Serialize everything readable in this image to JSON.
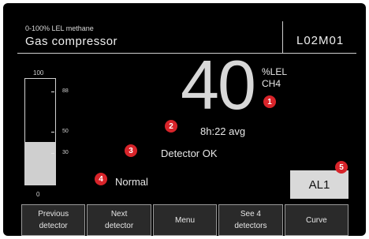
{
  "header": {
    "range_label": "0-100% LEL methane",
    "location": "Gas compressor",
    "code": "L02M01"
  },
  "gauge": {
    "max_label": "100",
    "min_label": "0",
    "fill_level": 0.4,
    "ticks": [
      {
        "label": "88",
        "level": 0.88
      },
      {
        "label": "50",
        "level": 0.5
      },
      {
        "label": "30",
        "level": 0.3
      }
    ]
  },
  "reading": {
    "value": "40",
    "unit": "%LEL",
    "gas": "CH4",
    "average": "8h:22 avg"
  },
  "status": {
    "detector": "Detector OK",
    "state": "Normal"
  },
  "alarm": {
    "label": "AL1"
  },
  "markers": [
    "1",
    "2",
    "3",
    "4",
    "5"
  ],
  "softkeys": [
    {
      "line1": "Previous",
      "line2": "detector"
    },
    {
      "line1": "Next",
      "line2": "detector"
    },
    {
      "line1": "Menu",
      "line2": ""
    },
    {
      "line1": "See 4",
      "line2": "detectors"
    },
    {
      "line1": "Curve",
      "line2": ""
    }
  ],
  "colors": {
    "background": "#000000",
    "marker": "#d8242a",
    "alarm_box": "#d9d9d9",
    "gauge_fill": "#cfcfcf"
  }
}
